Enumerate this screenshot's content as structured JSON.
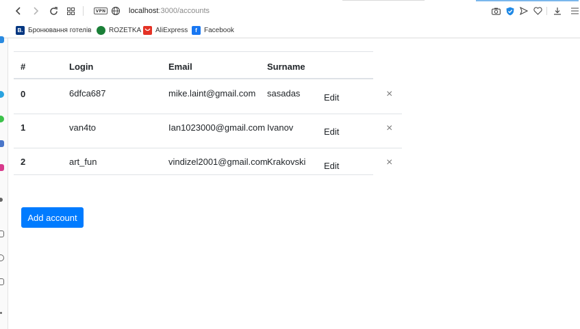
{
  "browser": {
    "url_host": "localhost",
    "url_path": ":3000/accounts",
    "vpn_label": "VPN"
  },
  "bookmarks": [
    {
      "label": "Бронювання готелів",
      "fav_text": "B.",
      "color": "#003580"
    },
    {
      "label": "ROZETKA",
      "fav_text": "",
      "color": "#1a7f37"
    },
    {
      "label": "AliExpress",
      "fav_text": "",
      "color": "#e43225"
    },
    {
      "label": "Facebook",
      "fav_text": "f",
      "color": "#1877f2"
    }
  ],
  "table": {
    "headers": [
      "#",
      "Login",
      "Email",
      "Surname"
    ],
    "rows": [
      {
        "id": "0",
        "login": "6dfca687",
        "email": "mike.laint@gmail.com",
        "surname": "sasadas",
        "edit": "Edit",
        "remove": "×"
      },
      {
        "id": "1",
        "login": "van4to",
        "email": "Ian1023000@gmail.com",
        "surname": "Ivanov",
        "edit": "Edit",
        "remove": "×"
      },
      {
        "id": "2",
        "login": "art_fun",
        "email": "vindizel2001@gmail.com",
        "surname": "Krakovski",
        "edit": "Edit",
        "remove": "×"
      }
    ]
  },
  "add_button_label": "Add account",
  "colors": {
    "primary": "#007bff",
    "vpn_shield": "#1e88e5"
  }
}
